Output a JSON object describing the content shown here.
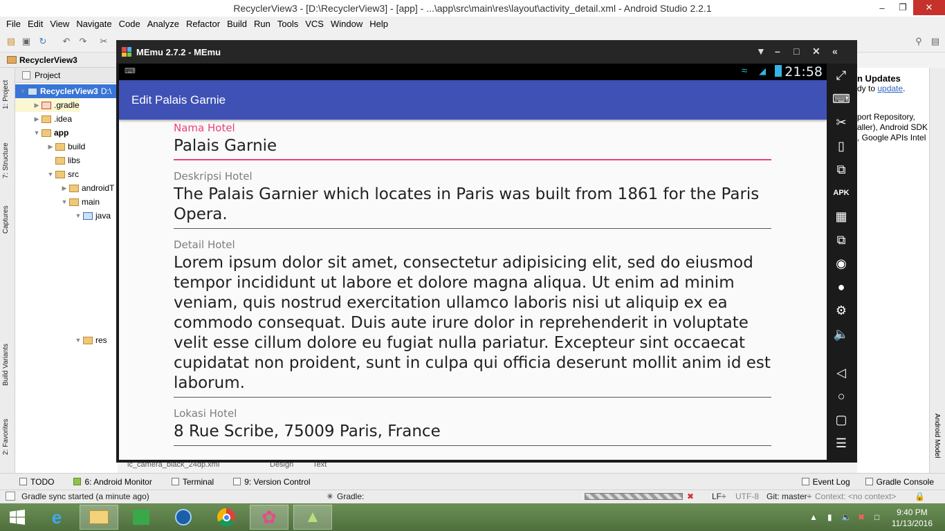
{
  "window": {
    "title": "RecyclerView3 - [D:\\RecyclerView3] - [app] - ...\\app\\src\\main\\res\\layout\\activity_detail.xml - Android Studio 2.2.1"
  },
  "menu": [
    "File",
    "Edit",
    "View",
    "Navigate",
    "Code",
    "Analyze",
    "Refactor",
    "Build",
    "Run",
    "Tools",
    "VCS",
    "Window",
    "Help"
  ],
  "breadcrumb": "RecyclerView3",
  "left_tabs": [
    "1: Project",
    "7: Structure",
    "Captures",
    "Build Variants",
    "2: Favorites"
  ],
  "project_panel": {
    "header": "Project",
    "tree": [
      {
        "label": "RecyclerView3",
        "suffix": "D:\\",
        "level": 0,
        "arrow": "▼",
        "icon": "blue"
      },
      {
        "label": ".gradle",
        "level": 1,
        "arrow": "▶",
        "icon": "red"
      },
      {
        "label": ".idea",
        "level": 1,
        "arrow": "▶",
        "icon": "plain"
      },
      {
        "label": "app",
        "level": 1,
        "arrow": "▼",
        "icon": "plain"
      },
      {
        "label": "build",
        "level": 2,
        "arrow": "▶",
        "icon": "plain"
      },
      {
        "label": "libs",
        "level": 2,
        "arrow": "",
        "icon": "plain"
      },
      {
        "label": "src",
        "level": 2,
        "arrow": "▼",
        "icon": "plain"
      },
      {
        "label": "androidT",
        "level": 3,
        "arrow": "▶",
        "icon": "plain"
      },
      {
        "label": "main",
        "level": 3,
        "arrow": "▼",
        "icon": "plain"
      },
      {
        "label": "java",
        "level": 4,
        "arrow": "▼",
        "icon": "blue"
      },
      {
        "label": "res",
        "level": 4,
        "arrow": "▼",
        "icon": "plain"
      }
    ]
  },
  "right_panel": {
    "updates_title": "n Updates",
    "updates_text": "dy to",
    "updates_link": "update",
    "sdk_lines": [
      "port Repository,",
      "aller), Android SDK",
      ", Google APIs Intel"
    ],
    "tab_label": "Android Model"
  },
  "editor": {
    "file_tab": "ic_camera_black_24dp.xml",
    "design_tab": "Design",
    "text_tab": "Text"
  },
  "bottom_tools": {
    "todo": "TODO",
    "android_monitor": "6: Android Monitor",
    "terminal": "Terminal",
    "version_control": "9: Version Control",
    "event_log": "Event Log",
    "gradle_console": "Gradle Console"
  },
  "status": {
    "message": "Gradle sync started (a minute ago)",
    "gradle": "Gradle:",
    "line_sep": "LF÷",
    "encoding": "UTF-8",
    "git": "Git: master÷",
    "context": "Context: <no context>"
  },
  "memu": {
    "title": "MEmu 2.7.2 - MEmu",
    "time": "21:58",
    "activity_title": "Edit Palais Garnie",
    "fields": [
      {
        "label": "Nama Hotel",
        "value": "Palais Garnie",
        "focused": true
      },
      {
        "label": "Deskripsi Hotel",
        "value": "The Palais Garnier which locates in Paris was built from 1861 for the Paris Opera.",
        "focused": false
      },
      {
        "label": "Detail Hotel",
        "value": "Lorem ipsum dolor sit amet, consectetur adipisicing elit, sed do eiusmod tempor incididunt ut labore et dolore magna aliqua. Ut enim ad minim veniam, quis nostrud exercitation ullamco laboris nisi ut aliquip ex ea commodo consequat. Duis aute irure dolor in reprehenderit in voluptate velit esse cillum dolore eu fugiat nulla pariatur. Excepteur sint occaecat cupidatat non proident, sunt in culpa qui officia deserunt mollit anim id est laborum.",
        "focused": false
      },
      {
        "label": "Lokasi Hotel",
        "value": "8 Rue Scribe, 75009 Paris, France",
        "focused": false
      }
    ]
  },
  "taskbar": {
    "time": "9:40 PM",
    "date": "11/13/2016"
  },
  "colors": {
    "appbar": "#3f51b5",
    "accent": "#ec407a"
  }
}
